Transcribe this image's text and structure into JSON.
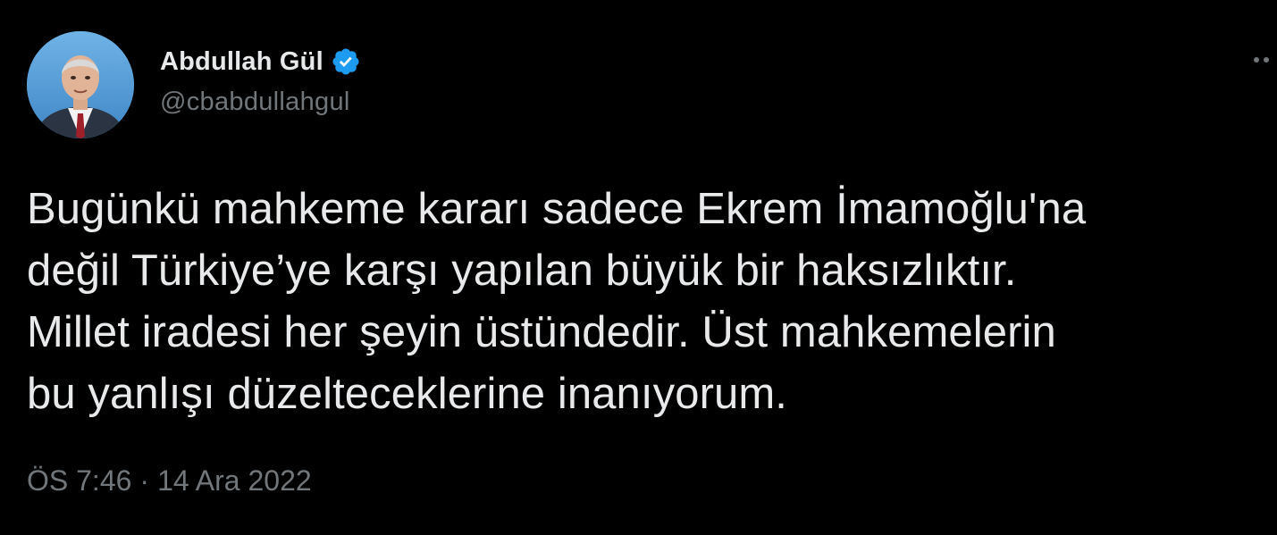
{
  "author": {
    "display_name": "Abdullah Gül",
    "handle": "@cbabdullahgul",
    "verified": true
  },
  "tweet": {
    "text": "Bugünkü mahkeme kararı sadece Ekrem İmamoğlu'na\ndeğil Türkiye’ye karşı yapılan büyük bir haksızlıktır.\nMillet iradesi her şeyin üstündedir. Üst mahkemelerin\nbu yanlışı düzelteceklerine inanıyorum.",
    "time": "ÖS 7:46",
    "separator": "·",
    "date": "14 Ara 2022"
  },
  "icons": {
    "verified": "verified-badge-icon",
    "more": "more-options-icon"
  },
  "colors": {
    "background": "#000000",
    "primary_text": "#e7e9ea",
    "secondary_text": "#71767b",
    "verified_blue": "#1d9bf0"
  }
}
